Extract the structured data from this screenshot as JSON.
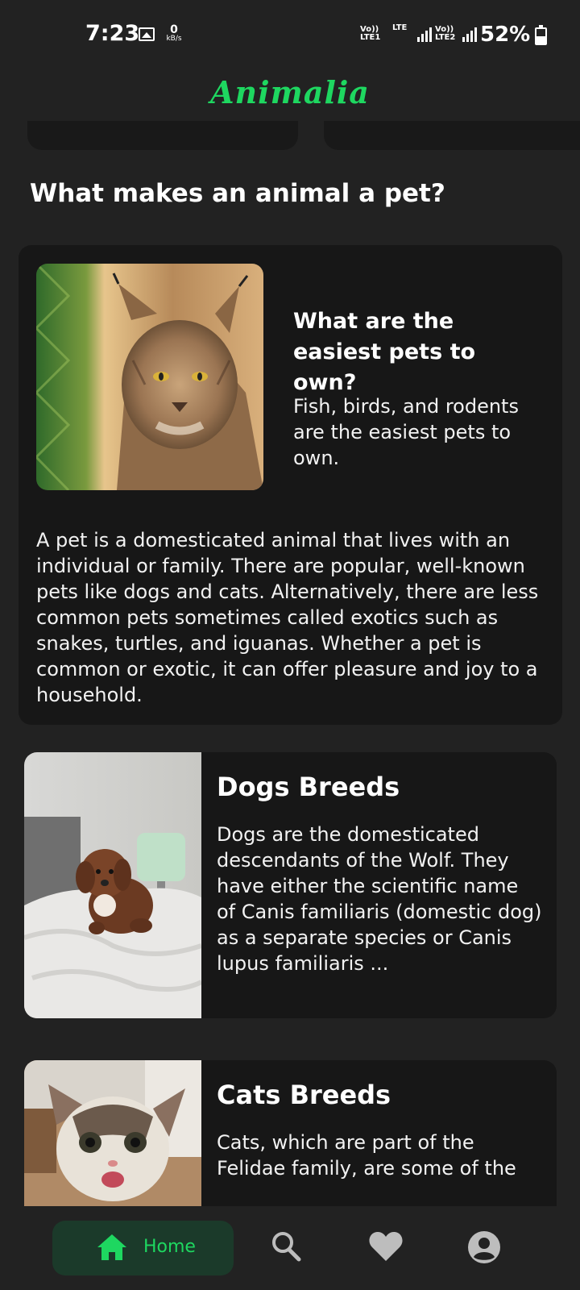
{
  "status_bar": {
    "time": "7:23",
    "speed_value": "0",
    "speed_unit": "kB/s",
    "sim1": "Vo)) LTE1",
    "lte": "LTE",
    "sim2": "Vo)) LTE2",
    "battery_text": "52%",
    "battery_level": 0.52
  },
  "app": {
    "title": "Animalia",
    "accent_color": "#1ed760",
    "background_color": "#222222",
    "card_color": "#171717"
  },
  "section": {
    "title": "What makes an animal a pet?"
  },
  "info_card": {
    "question": "What are the easiest pets to own?",
    "answer": "Fish, birds, and rodents are the easiest pets to own.",
    "body": "A pet is a domesticated animal that lives with an individual or family. There are popular, well-known pets like dogs and cats. Alternatively, there are less common pets sometimes called exotics such as snakes, turtles, and iguanas. Whether a pet is common or exotic, it can offer pleasure and joy to a household."
  },
  "breeds": [
    {
      "title": "Dogs Breeds",
      "text": "Dogs are the domesticated descendants of the Wolf. They have either the scientific name of Canis familiaris (domestic dog) as a separate species or Canis lupus familiaris ..."
    },
    {
      "title": "Cats Breeds",
      "text": "Cats, which are part of the Felidae family, are some of the"
    }
  ],
  "bottom_nav": {
    "home_label": "Home",
    "icons": [
      "home-icon",
      "search-icon",
      "heart-icon",
      "profile-icon"
    ]
  }
}
